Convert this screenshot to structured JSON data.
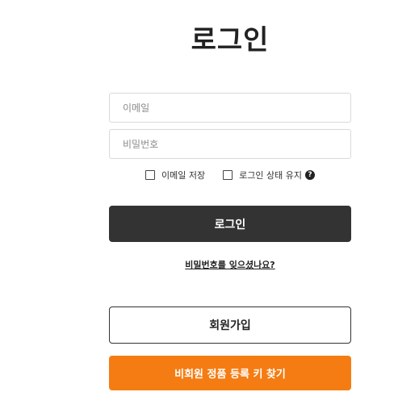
{
  "page": {
    "title": "로그인"
  },
  "form": {
    "email_placeholder": "이메일",
    "password_placeholder": "비밀번호",
    "save_email_label": "이메일 저장",
    "keep_login_label": "로그인 상태 유지",
    "help_icon_glyph": "?",
    "login_button_label": "로그인",
    "forgot_password_link": "비밀번호를 잊으셨나요?",
    "signup_button_label": "회원가입",
    "guest_key_button_label": "비회원 정품 등록 키 찾기"
  },
  "colors": {
    "login_button": "#333333",
    "guest_key_button": "#f57c12",
    "border": "#d9d9d9"
  },
  "icons": {
    "help": "question-circle-icon",
    "checkbox": "checkbox-unchecked-icon"
  }
}
